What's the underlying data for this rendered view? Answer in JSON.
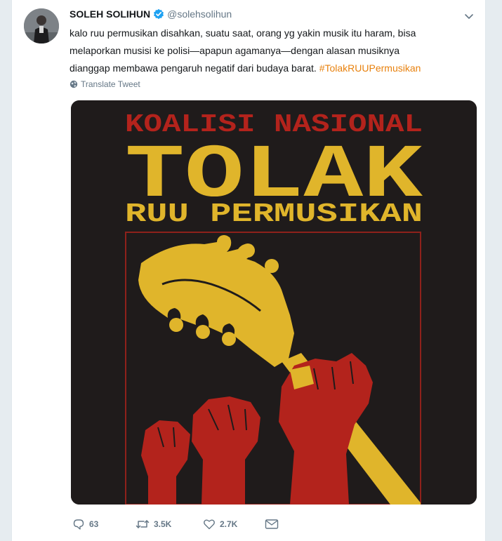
{
  "tweet": {
    "display_name": "SOLEH SOLIHUN",
    "handle": "@solehsolihun",
    "text_line_1": "kalo ruu permusikan disahkan, suatu saat, orang yg yakin musik itu haram, bisa",
    "text_line_2": "melaporkan musisi ke polisi—apapun agamanya—dengan alasan musiknya",
    "text_line_3": "dianggap membawa pengaruh negatif dari budaya barat.",
    "hashtag": "#TolakRUUPermusikan",
    "translate_label": "Translate Tweet",
    "icons": {
      "verified": "verified-badge-icon",
      "caret": "chevron-down-icon",
      "translate": "globe-icon",
      "reply": "reply-icon",
      "retweet": "retweet-icon",
      "like": "heart-icon",
      "message": "envelope-icon"
    },
    "colors": {
      "hashtag": "#e8810d",
      "verified": "#1da1f2",
      "poster_background": "#1f1b1b",
      "poster_red": "#b3231c",
      "poster_yellow": "#e0b52b"
    }
  },
  "poster": {
    "line_1": "KOALISI NASIONAL",
    "line_2": "TOLAK",
    "line_3": "RUU PERMUSIKAN"
  },
  "actions": {
    "replies": "63",
    "retweets": "3.5K",
    "likes": "2.7K"
  }
}
